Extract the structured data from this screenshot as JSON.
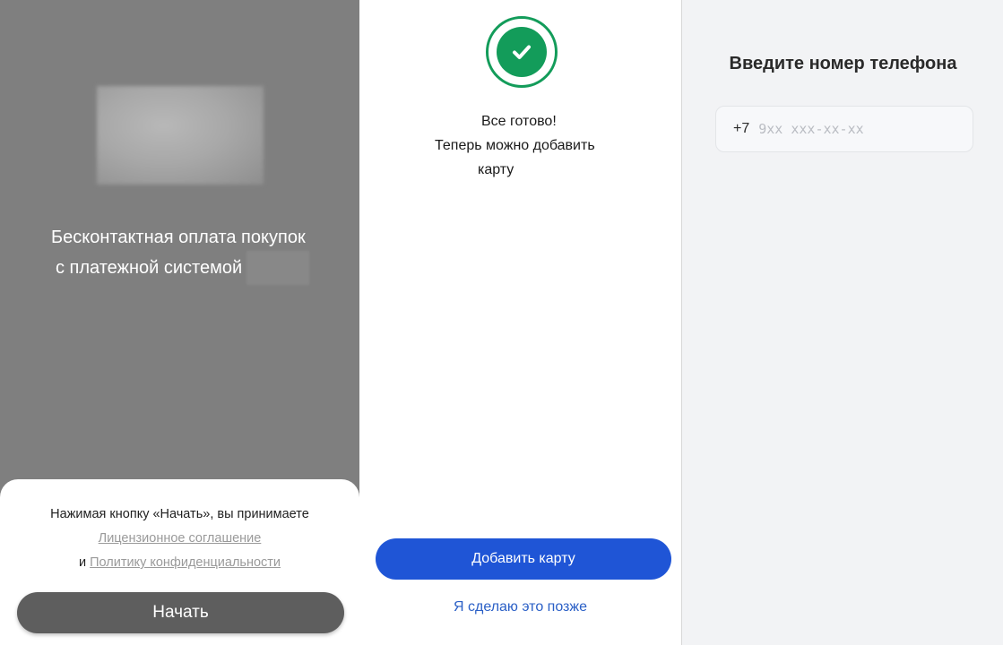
{
  "onboarding": {
    "promo_line1": "Бесконтактная оплата покупок",
    "promo_line2": "с платежной системой",
    "consent_text": "Нажимая кнопку «Начать», вы принимаете",
    "license_link": "Лицензионное соглашение",
    "and_text": "и",
    "privacy_link": "Политику конфиденциальности",
    "start_button": "Начать"
  },
  "success": {
    "line1": "Все готово!",
    "line2": "Теперь можно добавить",
    "line3": "карту",
    "add_card_button": "Добавить карту",
    "later_link": "Я сделаю это позже",
    "check_icon": "check-circle-icon"
  },
  "phone": {
    "title": "Введите номер телефона",
    "country_code": "+7",
    "placeholder": "9xx xxx-xx-xx",
    "value": ""
  },
  "colors": {
    "success_green": "#139c5a",
    "primary_blue": "#1f55d6",
    "link_blue": "#2a5fc6",
    "overlay_gray": "#7f7f7f"
  }
}
